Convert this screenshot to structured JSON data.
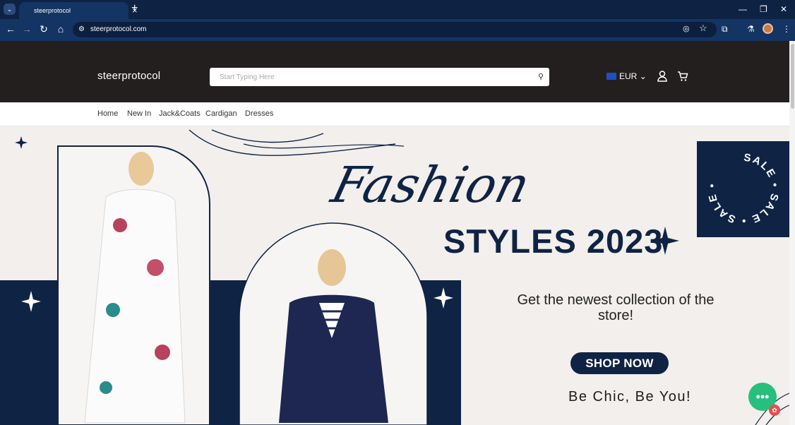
{
  "browser": {
    "tab_title": "steerprotocol",
    "url": "steerprotocol.com"
  },
  "header": {
    "logo": "steerprotocol",
    "search_placeholder": "Start Typing Here",
    "currency": "EUR"
  },
  "nav": {
    "items": [
      "Home",
      "New In",
      "Jack&Coats",
      "Cardigan",
      "Dresses"
    ]
  },
  "hero": {
    "script_title": "Fashion",
    "styles_title": "STYLES 2023",
    "subtitle": "Get the newest collection of the store!",
    "cta": "SHOP NOW",
    "tagline": "Be Chic, Be You!",
    "sale_text": "SALE • SALE • SALE •"
  },
  "colors": {
    "navy": "#0f2344",
    "header_bg": "#231f1e",
    "hero_bg": "#f2efec",
    "chat_green": "#25c07b"
  }
}
